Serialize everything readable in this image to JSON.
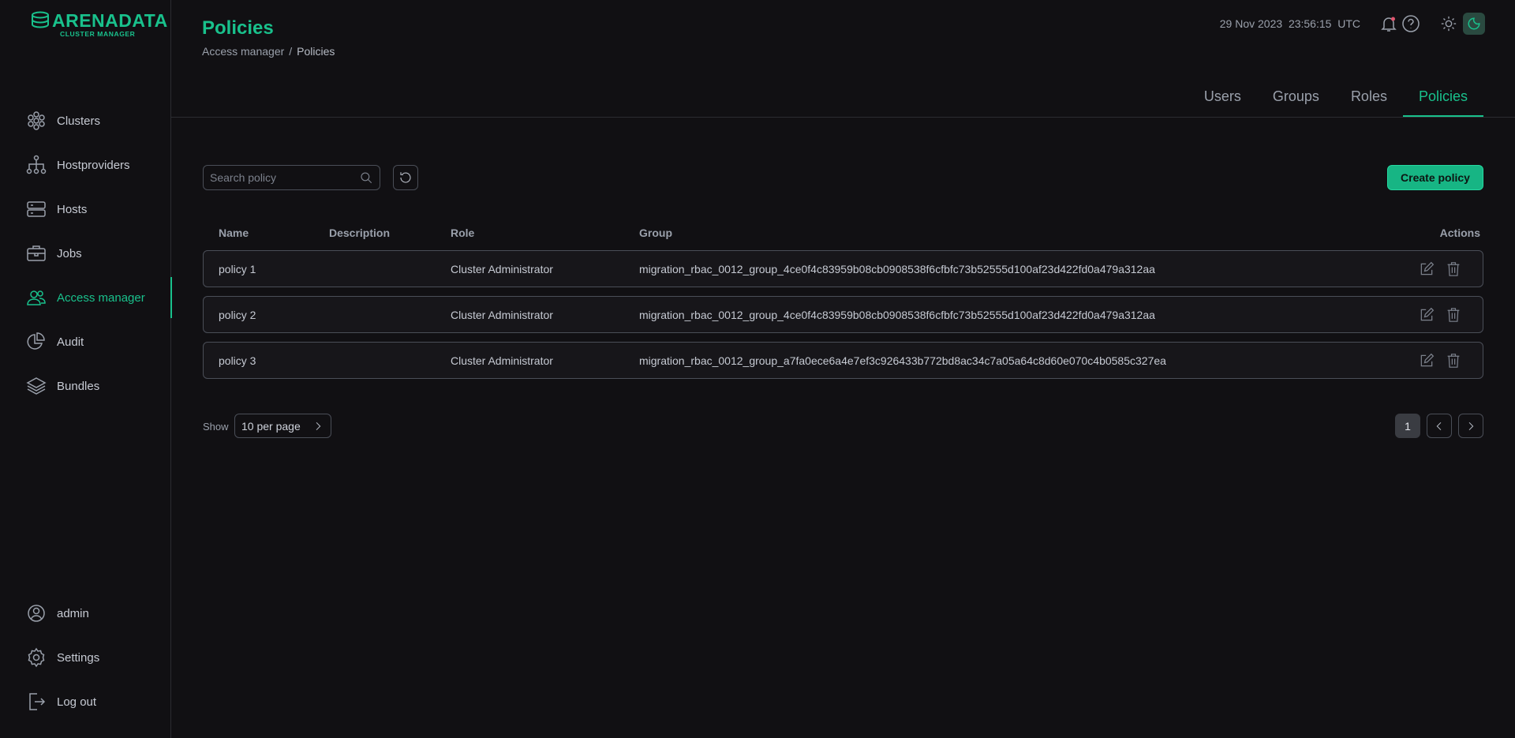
{
  "brand": {
    "name": "ARENADATA",
    "sub": "CLUSTER MANAGER",
    "accent": "#19c18c"
  },
  "sidebar": {
    "items": [
      {
        "label": "Clusters",
        "icon": "clusters-icon"
      },
      {
        "label": "Hostproviders",
        "icon": "hostproviders-icon"
      },
      {
        "label": "Hosts",
        "icon": "hosts-icon"
      },
      {
        "label": "Jobs",
        "icon": "jobs-icon"
      },
      {
        "label": "Access manager",
        "icon": "access-manager-icon",
        "active": true
      },
      {
        "label": "Audit",
        "icon": "audit-icon"
      },
      {
        "label": "Bundles",
        "icon": "bundles-icon"
      }
    ],
    "bottom": [
      {
        "label": "admin",
        "icon": "user-icon"
      },
      {
        "label": "Settings",
        "icon": "gear-icon"
      },
      {
        "label": "Log out",
        "icon": "logout-icon"
      }
    ]
  },
  "header": {
    "title": "Policies",
    "breadcrumb": {
      "parent": "Access manager",
      "separator": "/",
      "current": "Policies"
    },
    "datetime": "29 Nov 2023  23:56:15  UTC"
  },
  "tabs": [
    {
      "label": "Users"
    },
    {
      "label": "Groups"
    },
    {
      "label": "Roles"
    },
    {
      "label": "Policies",
      "active": true
    }
  ],
  "toolbar": {
    "search_placeholder": "Search policy",
    "create_label": "Create policy"
  },
  "table": {
    "columns": {
      "name": "Name",
      "description": "Description",
      "role": "Role",
      "group": "Group",
      "actions": "Actions"
    },
    "rows": [
      {
        "name": "policy 1",
        "description": "",
        "role": "Cluster Administrator",
        "group": "migration_rbac_0012_group_4ce0f4c83959b08cb0908538f6cfbfc73b52555d100af23d422fd0a479a312aa"
      },
      {
        "name": "policy 2",
        "description": "",
        "role": "Cluster Administrator",
        "group": "migration_rbac_0012_group_4ce0f4c83959b08cb0908538f6cfbfc73b52555d100af23d422fd0a479a312aa"
      },
      {
        "name": "policy 3",
        "description": "",
        "role": "Cluster Administrator",
        "group": "migration_rbac_0012_group_a7fa0ece6a4e7ef3c926433b772bd8ac34c7a05a64c8d60e070c4b0585c327ea"
      }
    ]
  },
  "pagination": {
    "show_label": "Show",
    "per_page": "10 per page",
    "current_page": "1"
  }
}
